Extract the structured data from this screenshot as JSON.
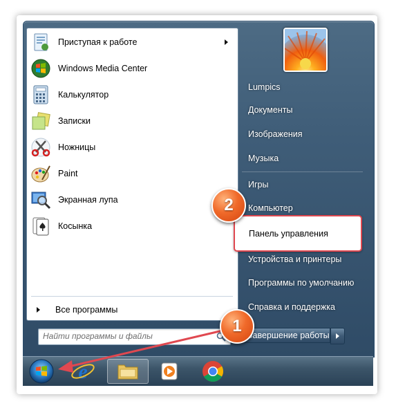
{
  "programs": [
    {
      "label": "Приступая к работе",
      "icon": "getting-started-icon",
      "has_submenu": true
    },
    {
      "label": "Windows Media Center",
      "icon": "media-center-icon",
      "has_submenu": false
    },
    {
      "label": "Калькулятор",
      "icon": "calculator-icon",
      "has_submenu": false
    },
    {
      "label": "Записки",
      "icon": "sticky-notes-icon",
      "has_submenu": false
    },
    {
      "label": "Ножницы",
      "icon": "scissors-icon",
      "has_submenu": false
    },
    {
      "label": "Paint",
      "icon": "paint-palette-icon",
      "has_submenu": false
    },
    {
      "label": "Экранная лупа",
      "icon": "magnifier-icon",
      "has_submenu": false
    },
    {
      "label": "Косынка",
      "icon": "solitaire-icon",
      "has_submenu": false
    }
  ],
  "all_programs_label": "Все программы",
  "search": {
    "placeholder": "Найти программы и файлы"
  },
  "right_items": [
    {
      "label": "Lumpics"
    },
    {
      "label": "Документы"
    },
    {
      "label": "Изображения"
    },
    {
      "label": "Музыка"
    },
    {
      "label": "Игры"
    },
    {
      "label": "Компьютер"
    },
    {
      "label": "Панель управления"
    },
    {
      "label": "Устройства и принтеры"
    },
    {
      "label": "Программы по умолчанию"
    },
    {
      "label": "Справка и поддержка"
    }
  ],
  "shutdown_label": "Завершение работы",
  "annotations": {
    "step1": "1",
    "step2": "2",
    "accent_color": "#e04850"
  },
  "taskbar": {
    "items": [
      "start-orb-icon",
      "internet-explorer-icon",
      "explorer-folder-icon",
      "media-player-icon",
      "chrome-icon"
    ]
  }
}
